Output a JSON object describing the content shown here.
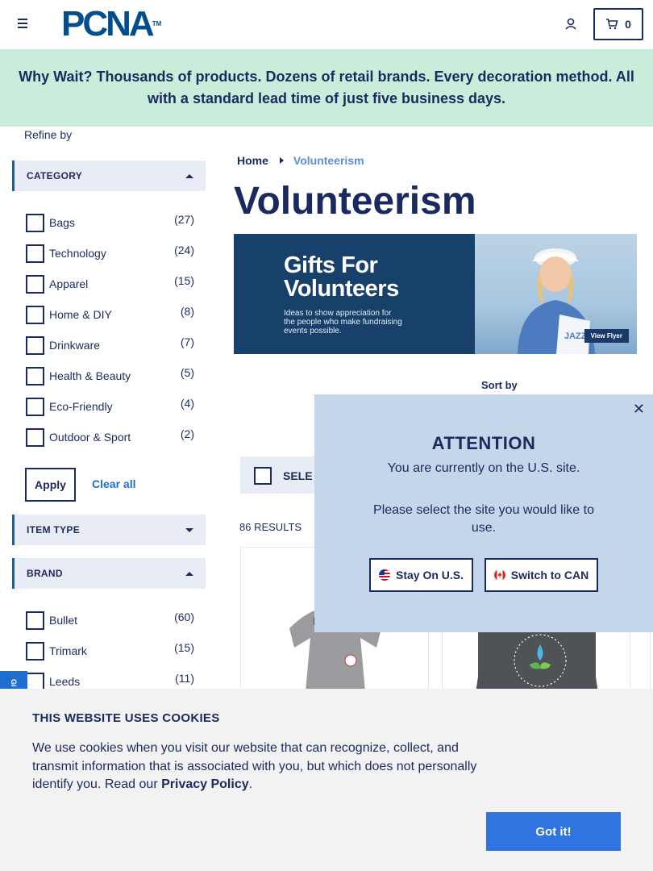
{
  "header": {
    "logo_text": "PCNA",
    "logo_tm": "TM",
    "cart_count": "0"
  },
  "promo": {
    "text": "Why Wait? Thousands of products. Dozens of retail brands. Every decoration method. All with a standard lead time of just five business days."
  },
  "sidebar": {
    "refine_label": "Refine by",
    "category": {
      "title": "CATEGORY",
      "items": [
        {
          "label": "Bags",
          "count": "(27)"
        },
        {
          "label": "Technology",
          "count": "(24)"
        },
        {
          "label": "Apparel",
          "count": "(15)"
        },
        {
          "label": "Home & DIY",
          "count": "(8)"
        },
        {
          "label": "Drinkware",
          "count": "(7)"
        },
        {
          "label": "Health & Beauty",
          "count": "(5)"
        },
        {
          "label": "Eco-Friendly",
          "count": "(4)"
        },
        {
          "label": "Outdoor & Sport",
          "count": "(2)"
        }
      ]
    },
    "apply_label": "Apply",
    "clear_all_label": "Clear all",
    "item_type": {
      "title": "ITEM TYPE"
    },
    "brand": {
      "title": "BRAND",
      "items": [
        {
          "label": "Bullet",
          "count": "(60)"
        },
        {
          "label": "Trimark",
          "count": "(15)"
        },
        {
          "label": "Leeds",
          "count": "(11)"
        }
      ]
    },
    "feedback_tab": "Gi"
  },
  "main": {
    "breadcrumb": {
      "home": "Home",
      "current": "Volunteerism"
    },
    "title": "Volunteerism",
    "hero": {
      "heading_line1": "Gifts For",
      "heading_line2": "Volunteers",
      "subtext": "Ideas to show appreciation for the people who make fundraising events possible.",
      "view_flyer": "View Flyer",
      "bag_text": "JAZZ FEST"
    },
    "sort_by_label": "Sort by",
    "select_label": "SELE",
    "results_label": "86 RESULTS"
  },
  "modal": {
    "title": "ATTENTION",
    "message1": "You are currently on the U.S. site.",
    "message2": "Please select the site you would like to use.",
    "stay_label": "Stay On U.S.",
    "switch_label": "Switch to CAN",
    "close_symbol": "✕"
  },
  "cookie": {
    "title": "THIS WEBSITE USES COOKIES",
    "text": "We use cookies when you visit our website that can recognize, collect, and transmit information that is associated with you, but which does not personally identify you. Read our ",
    "link": "Privacy Policy",
    "end": ".",
    "button": "Got it!"
  },
  "colors": {
    "navy": "#1b2a5e",
    "promo_bg": "#c9ecdb",
    "facet_bg": "#e8edf5",
    "modal_bg": "#c3d6ea",
    "accent_blue": "#2f74e0",
    "hero_bg": "#17406b"
  },
  "icons": [
    "menu-icon",
    "account-icon",
    "cart-icon",
    "caret-up-icon",
    "caret-down-icon",
    "close-icon",
    "us-flag-icon",
    "canada-flag-icon"
  ]
}
